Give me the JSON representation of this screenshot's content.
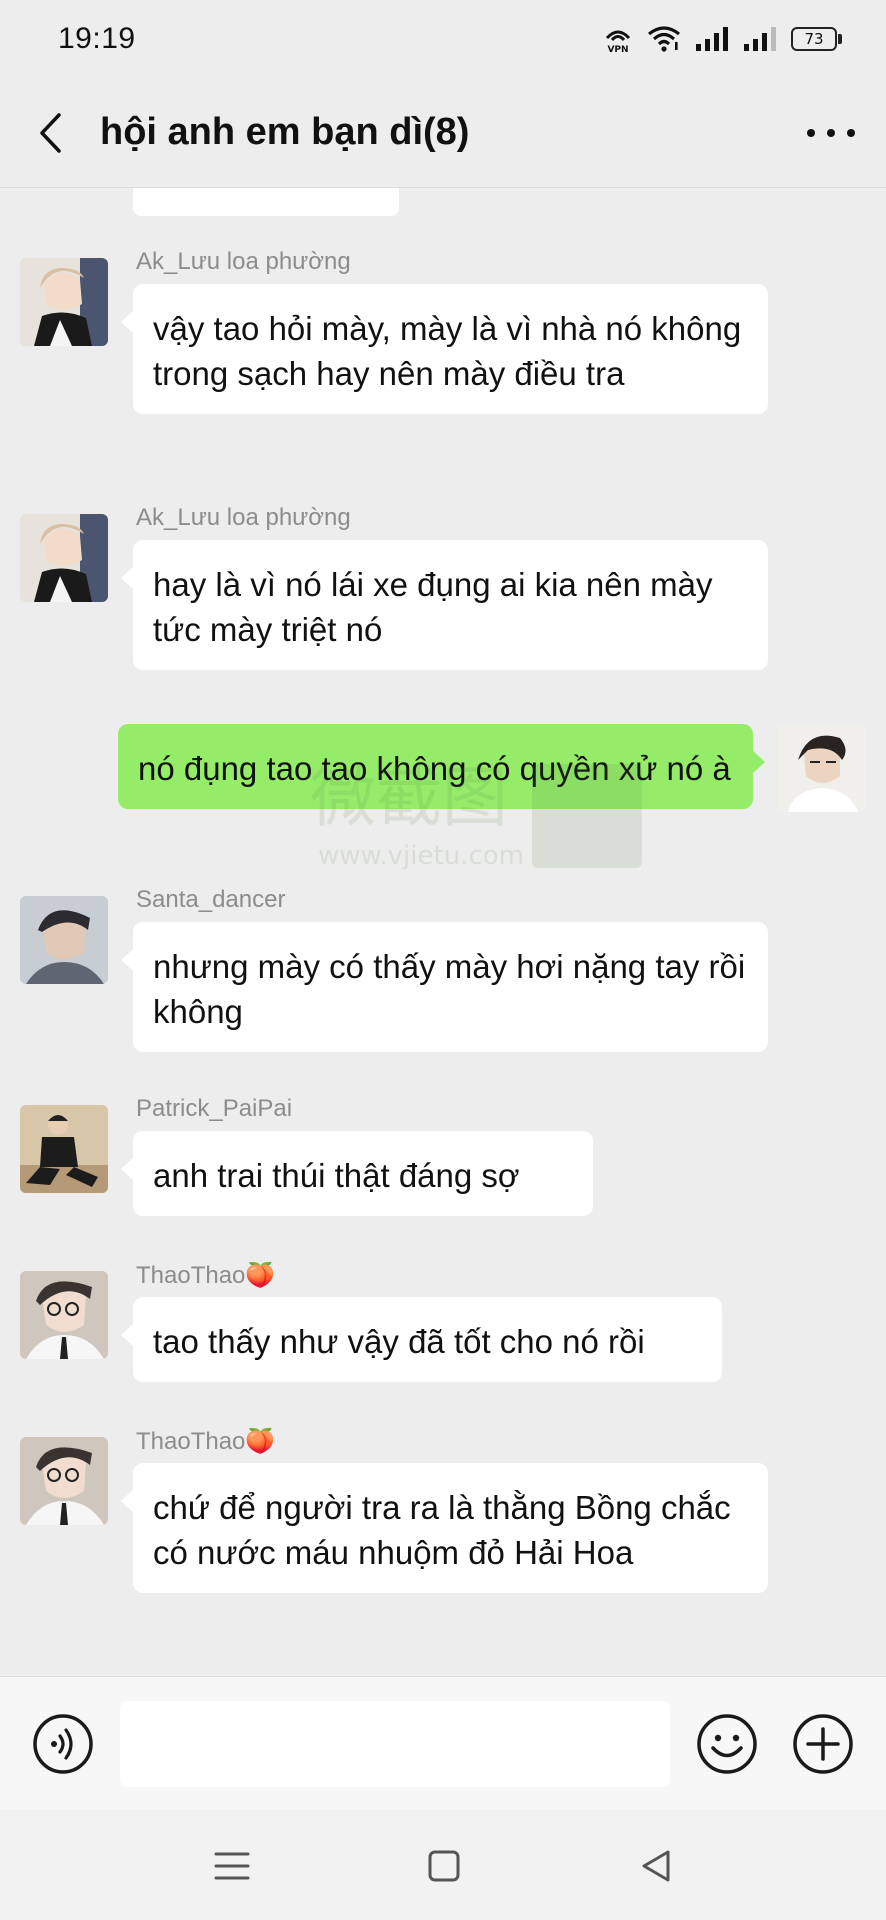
{
  "status_bar": {
    "time": "19:19",
    "vpn_label": "VPN",
    "battery": "73"
  },
  "header": {
    "title": "hội anh em bạn dì(8)"
  },
  "colors": {
    "background": "#ededed",
    "incoming_bubble": "#ffffff",
    "outgoing_bubble": "#95ec69",
    "sender_name": "#8c8c8c"
  },
  "messages": [
    {
      "sender": "Ak_Lưu loa phường",
      "text": "vậy tao hỏi mày, mày là vì nhà nó không trong sạch hay nên mày điều tra",
      "direction": "incoming"
    },
    {
      "sender": "Ak_Lưu loa phường",
      "text": "hay là vì nó lái xe đụng ai kia nên mày tức mày triệt nó",
      "direction": "incoming"
    },
    {
      "sender": "",
      "text": "nó đụng tao tao không có quyền xử nó à",
      "direction": "outgoing"
    },
    {
      "sender": "Santa_dancer",
      "text": "nhưng mày có thấy mày hơi nặng tay rồi không",
      "direction": "incoming"
    },
    {
      "sender": "Patrick_PaiPai",
      "text": "anh trai thúi thật đáng sợ",
      "direction": "incoming"
    },
    {
      "sender": "ThaoThao🍑",
      "text": "tao thấy như vậy đã tốt cho nó rồi",
      "direction": "incoming"
    },
    {
      "sender": "ThaoThao🍑",
      "text": "chứ để người tra ra là thằng Bồng chắc có nước máu nhuộm đỏ Hải Hoa",
      "direction": "incoming"
    }
  ],
  "watermark": {
    "brand": "微截图",
    "url": "www.vjietu.com"
  },
  "input": {
    "value": "",
    "placeholder": ""
  },
  "icons": {
    "back": "back-arrow-icon",
    "more": "more-dots-icon",
    "voice": "voice-icon",
    "emoji": "emoji-icon",
    "plus": "plus-icon",
    "nav_menu": "menu-icon",
    "nav_home": "home-icon",
    "nav_back": "nav-back-icon"
  }
}
